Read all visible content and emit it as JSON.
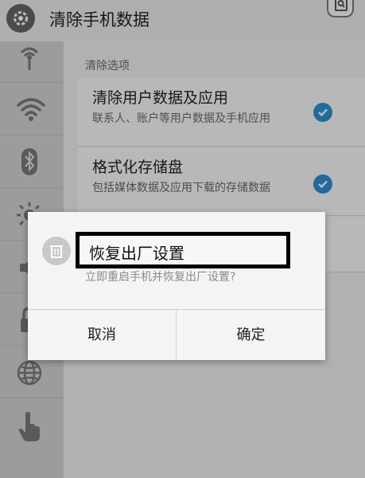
{
  "header": {
    "title": "清除手机数据",
    "settings_icon": "gear-icon",
    "action_icon": "search-screen-icon"
  },
  "sidebar": {
    "items": [
      {
        "icon": "antenna-icon"
      },
      {
        "icon": "wifi-icon"
      },
      {
        "icon": "bluetooth-icon"
      },
      {
        "icon": "brightness-icon"
      },
      {
        "icon": "volume-icon"
      },
      {
        "icon": "lock-icon"
      },
      {
        "icon": "globe-icon"
      },
      {
        "icon": "hand-pointer-icon"
      }
    ]
  },
  "content": {
    "section_label": "清除选项",
    "options": [
      {
        "title": "清除用户数据及应用",
        "subtitle": "联系人、账户等用户数据及手机应用",
        "checked": true
      },
      {
        "title": "格式化存储盘",
        "subtitle": "包括媒体数据及应用下载的存储数据",
        "checked": true
      }
    ]
  },
  "dialog": {
    "title": "恢复出厂设置",
    "message": "立即重启手机并恢复出厂设置?",
    "icon": "trash-icon",
    "cancel_label": "取消",
    "confirm_label": "确定"
  },
  "colors": {
    "accent": "#2f8fd1",
    "sidebar_bg": "#d3d3d3",
    "dialog_bg": "#f4f4f4"
  }
}
